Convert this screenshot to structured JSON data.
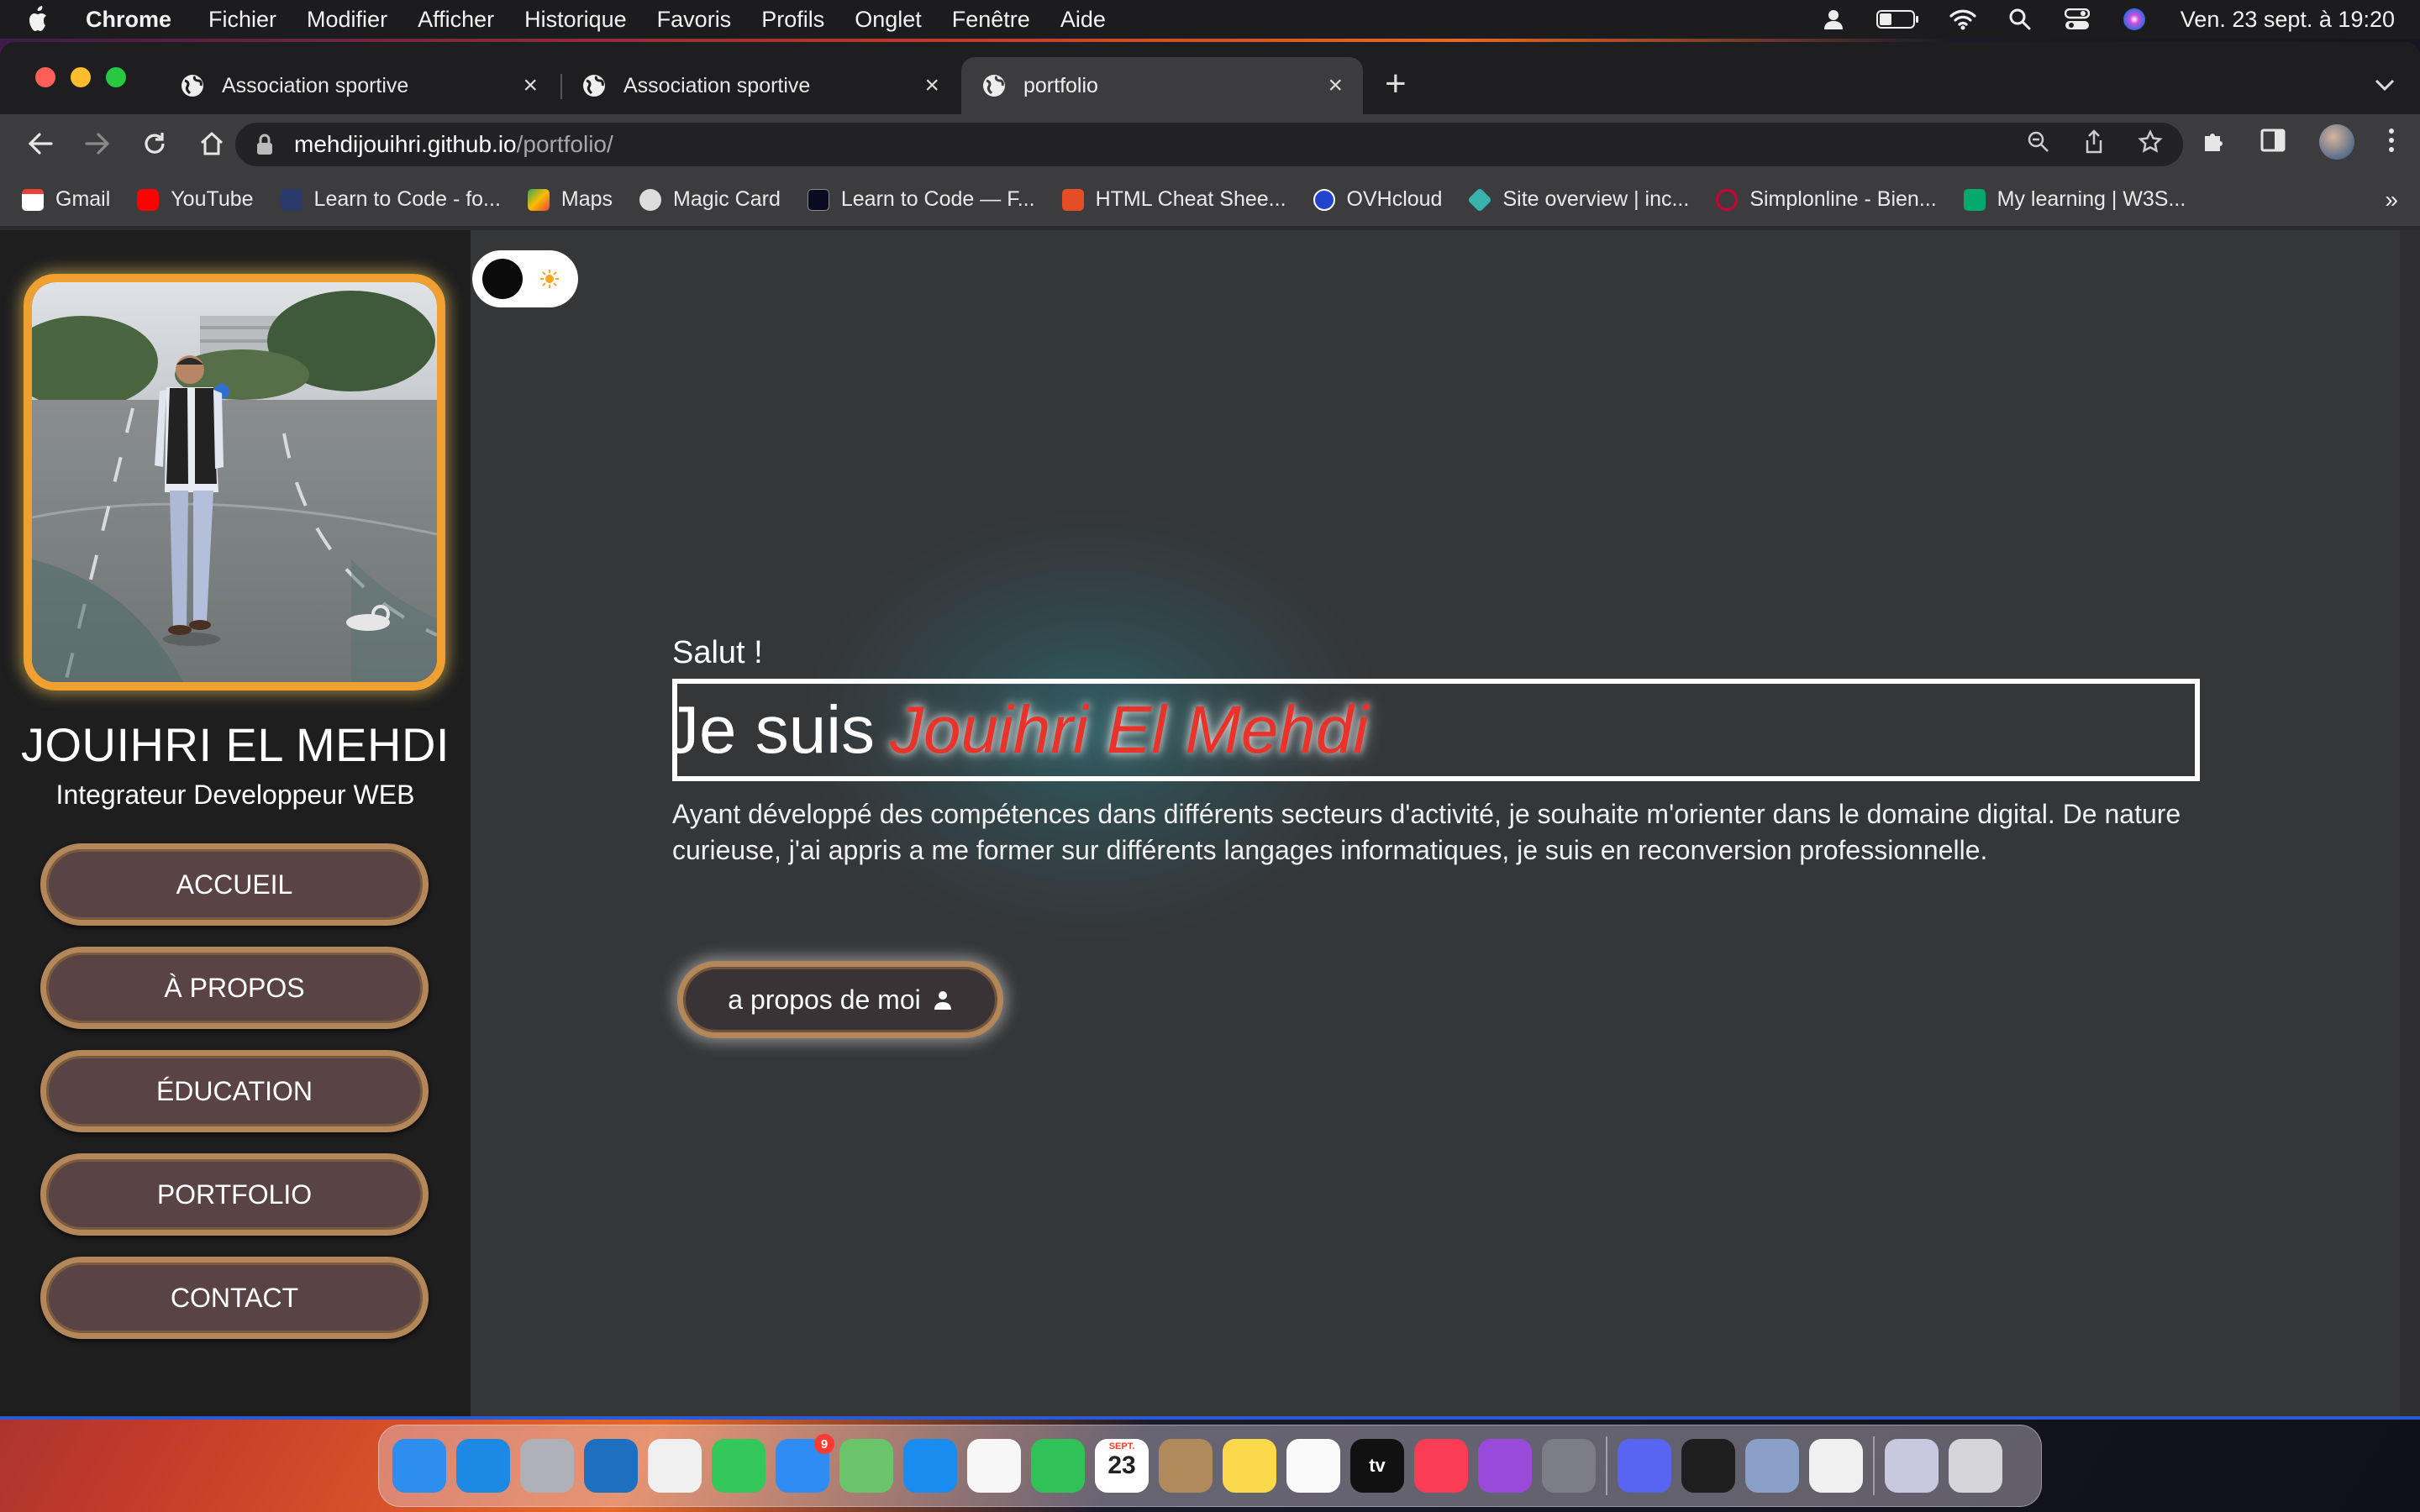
{
  "menubar": {
    "app_name": "Chrome",
    "items": [
      "Fichier",
      "Modifier",
      "Afficher",
      "Historique",
      "Favoris",
      "Profils",
      "Onglet",
      "Fenêtre",
      "Aide"
    ],
    "clock": "Ven. 23 sept. à  19:20"
  },
  "browser": {
    "tabs": [
      {
        "title": "Association sportive",
        "active": false
      },
      {
        "title": "Association sportive",
        "active": false
      },
      {
        "title": "portfolio",
        "active": true
      }
    ],
    "url_host": "mehdijouihri.github.io",
    "url_path": "/portfolio/",
    "bookmarks": [
      {
        "label": "Gmail",
        "icon": "gmail-icon",
        "color": "#ea4335"
      },
      {
        "label": "YouTube",
        "icon": "youtube-icon",
        "color": "#ff0000"
      },
      {
        "label": "Learn to Code - fo...",
        "icon": "freecodecamp-icon",
        "color": "#2a3a6a"
      },
      {
        "label": "Maps",
        "icon": "maps-icon",
        "color": "#34a853"
      },
      {
        "label": "Magic Card",
        "icon": "magic-card-icon",
        "color": "#dddddd"
      },
      {
        "label": "Learn to Code — F...",
        "icon": "freecodecamp-icon",
        "color": "#0a0a23"
      },
      {
        "label": "HTML Cheat Shee...",
        "icon": "html-icon",
        "color": "#e44d26"
      },
      {
        "label": "OVHcloud",
        "icon": "ovhcloud-icon",
        "color": "#2244cc"
      },
      {
        "label": "Site overview | inc...",
        "icon": "diamond-icon",
        "color": "#38b2ac"
      },
      {
        "label": "Simplonline - Bien...",
        "icon": "simplon-icon",
        "color": "#ce0033"
      },
      {
        "label": "My learning | W3S...",
        "icon": "w3schools-icon",
        "color": "#04aa6d"
      }
    ]
  },
  "sidebar": {
    "name": "JOUIHRI EL MEHDI",
    "role": "Integrateur Developpeur WEB",
    "nav": [
      "ACCUEIL",
      "À PROPOS",
      "ÉDUCATION",
      "PORTFOLIO",
      "CONTACT"
    ]
  },
  "hero": {
    "greeting": "Salut !",
    "headline_lead": "Je suis",
    "headline_name": "Jouihri El Mehdi",
    "intro": "Ayant développé des compétences dans différents secteurs d'activité, je souhaite m'orienter dans le domaine digital. De nature curieuse, j'ai appris a me former sur différents langages informatiques, je suis en reconversion professionnelle.",
    "about_button": "a propos de moi"
  },
  "colors": {
    "accent_red": "#e8322a",
    "frame_orange": "#f0a030",
    "button_border": "#b4875a",
    "button_fill": "#5a4344"
  },
  "dock": {
    "apps": [
      {
        "name": "finder-icon",
        "color": "#2d8ef0"
      },
      {
        "name": "safari-icon",
        "color": "#1e88e5"
      },
      {
        "name": "launchpad-icon",
        "color": "#b0b0b8"
      },
      {
        "name": "vscode-icon",
        "color": "#1f6fc1"
      },
      {
        "name": "chrome-icon",
        "color": "#f0f0f0"
      },
      {
        "name": "messages-icon",
        "color": "#34c759"
      },
      {
        "name": "mail-icon",
        "color": "#2f8cf5",
        "badge": "9"
      },
      {
        "name": "maps-icon",
        "color": "#6ac46a"
      },
      {
        "name": "app-store-icon",
        "color": "#1a8cf0"
      },
      {
        "name": "photos-icon",
        "color": "#f7f7f7"
      },
      {
        "name": "facetime-icon",
        "color": "#30c158"
      },
      {
        "name": "calendar-icon",
        "color": "#ffffff",
        "label": "23",
        "month": "SEPT."
      },
      {
        "name": "contacts-icon",
        "color": "#b08a5a"
      },
      {
        "name": "notes-icon",
        "color": "#fcd94a"
      },
      {
        "name": "reminders-icon",
        "color": "#fafafa"
      },
      {
        "name": "apple-tv-icon",
        "color": "#111111",
        "label": "tv"
      },
      {
        "name": "music-icon",
        "color": "#fa3c55"
      },
      {
        "name": "podcasts-icon",
        "color": "#9a4ad9"
      },
      {
        "name": "system-settings-icon",
        "color": "#7d7d85"
      },
      {
        "name": "discord-icon",
        "color": "#5865f2"
      },
      {
        "name": "figma-icon",
        "color": "#1e1e1e"
      },
      {
        "name": "preview-icon",
        "color": "#8aa0c8"
      },
      {
        "name": "chrome-canary-icon",
        "color": "#f0f0f0"
      },
      {
        "name": "discord-window-icon",
        "color": "#c8c8e0"
      },
      {
        "name": "trash-icon",
        "color": "#d6d6da"
      }
    ]
  }
}
